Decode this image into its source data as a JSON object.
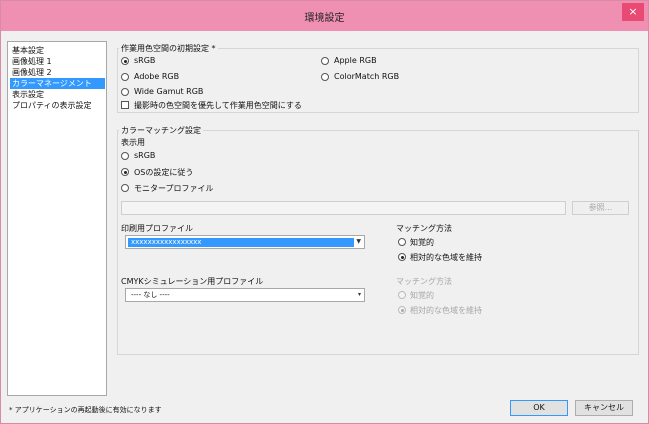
{
  "window": {
    "title": "環境設定",
    "close_glyph": "×"
  },
  "sidebar": {
    "items": [
      {
        "label": "基本設定"
      },
      {
        "label": "画像処理 1"
      },
      {
        "label": "画像処理 2"
      },
      {
        "label": "カラーマネージメント",
        "selected": true
      },
      {
        "label": "表示設定"
      },
      {
        "label": "プロパティの表示設定"
      }
    ]
  },
  "working_space": {
    "title": "作業用色空間の初期設定 *",
    "options": [
      {
        "label": "sRGB",
        "checked": true
      },
      {
        "label": "Apple RGB",
        "checked": false
      },
      {
        "label": "Adobe RGB",
        "checked": false
      },
      {
        "label": "ColorMatch RGB",
        "checked": false
      },
      {
        "label": "Wide Gamut RGB",
        "checked": false
      }
    ],
    "checkbox_label": "撮影時の色空間を優先して作業用色空間にする"
  },
  "color_matching": {
    "title": "カラーマッチング設定",
    "display_label": "表示用",
    "display_options": [
      {
        "label": "sRGB",
        "checked": false
      },
      {
        "label": "OSの設定に従う",
        "checked": true
      },
      {
        "label": "モニタープロファイル",
        "checked": false
      }
    ],
    "browse_label": "参照...",
    "print_profile_label": "印刷用プロファイル",
    "print_profile_value": "xxxxxxxxxxxxxxxxx",
    "print_intent_label": "マッチング方法",
    "print_intents": [
      {
        "label": "知覚的",
        "checked": false
      },
      {
        "label": "相対的な色域を維持",
        "checked": true
      }
    ],
    "cmyk_profile_label": "CMYKシミュレーション用プロファイル",
    "cmyk_profile_value": "---- なし ----",
    "cmyk_intent_label": "マッチング方法",
    "cmyk_intents": [
      {
        "label": "知覚的",
        "checked": false
      },
      {
        "label": "相対的な色域を維持",
        "checked": true
      }
    ]
  },
  "footer": {
    "note": "* アプリケーションの再起動後に有効になります",
    "ok_label": "OK",
    "cancel_label": "キャンセル"
  },
  "colors": {
    "titlebar": "#ef8fb2",
    "close": "#e84a73",
    "selection": "#3399ff"
  }
}
